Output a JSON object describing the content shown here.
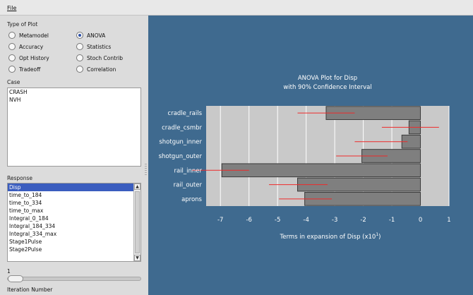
{
  "menubar": {
    "file_label": "File"
  },
  "type_of_plot": {
    "label": "Type of Plot",
    "options": [
      {
        "label": "Metamodel",
        "selected": false
      },
      {
        "label": "ANOVA",
        "selected": true
      },
      {
        "label": "Accuracy",
        "selected": false
      },
      {
        "label": "Statistics",
        "selected": false
      },
      {
        "label": "Opt History",
        "selected": false
      },
      {
        "label": "Stoch Contrib",
        "selected": false
      },
      {
        "label": "Tradeoff",
        "selected": false
      },
      {
        "label": "Correlation",
        "selected": false
      }
    ]
  },
  "case": {
    "label": "Case",
    "items": [
      "CRASH",
      "NVH"
    ]
  },
  "response": {
    "label": "Response",
    "items": [
      "Disp",
      "time_to_184",
      "time_to_334",
      "time_to_max",
      "Integral_0_184",
      "Integral_184_334",
      "Integral_334_max",
      "Stage1Pulse",
      "Stage2Pulse"
    ],
    "selected_index": 0
  },
  "iteration": {
    "value": "1",
    "label": "Iteration Number",
    "level": 0
  },
  "colors": {
    "panel_bg": "#3f6a8f",
    "plot_bg": "#c9c9c9",
    "bar_fill": "#7f7f7f",
    "interval_line": "#ee2a2a",
    "selection": "#3a5dbf"
  },
  "chart_data": {
    "type": "bar",
    "orientation": "horizontal",
    "title": "ANOVA Plot for Disp",
    "subtitle": "with 90% Confidence Interval",
    "xlabel": "Terms in expansion of Disp (x10",
    "xlabel_exponent": "1",
    "xlabel_suffix": ")",
    "xlim": [
      -7.5,
      1
    ],
    "xticks": [
      -7,
      -6,
      -5,
      -4,
      -3,
      -2,
      -1,
      0,
      1
    ],
    "grid": true,
    "categories": [
      "cradle_rails",
      "cradle_csmbr",
      "shotgun_inner",
      "shotgun_outer",
      "rail_inner",
      "rail_outer",
      "aprons"
    ],
    "values": [
      -3.3,
      -0.4,
      -0.65,
      -2.05,
      -6.95,
      -4.3,
      -4.05
    ],
    "intervals": [
      [
        -4.3,
        -2.3
      ],
      [
        -1.35,
        0.65
      ],
      [
        -2.3,
        -0.45
      ],
      [
        -2.95,
        -1.15
      ],
      [
        -8.0,
        -6.0
      ],
      [
        -5.3,
        -3.25
      ],
      [
        -4.95,
        -3.1
      ]
    ]
  }
}
